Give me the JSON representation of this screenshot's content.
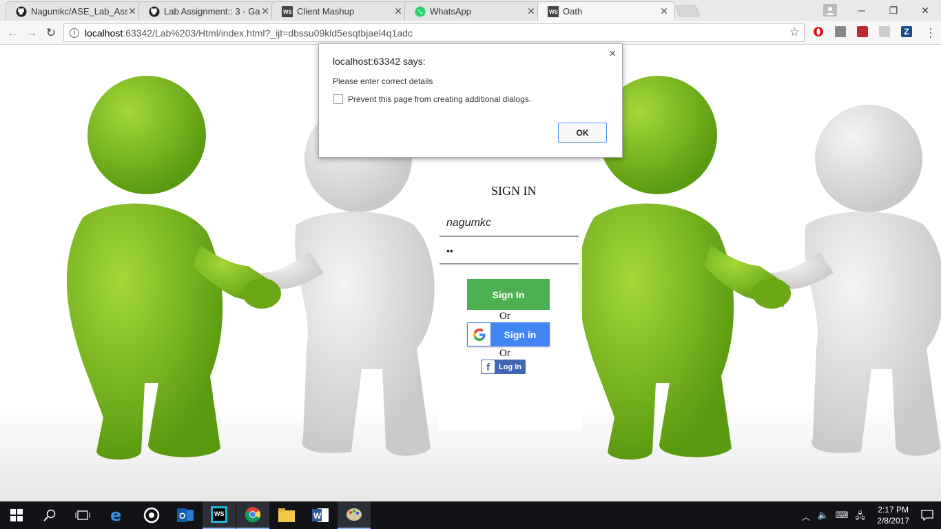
{
  "browser": {
    "tabs": [
      {
        "title": "Nagumkc/ASE_Lab_Assig",
        "icon": "github-icon"
      },
      {
        "title": "Lab Assignment:: 3 - Gay",
        "icon": "github-icon"
      },
      {
        "title": "Client Mashup",
        "icon": "webstorm-icon"
      },
      {
        "title": "WhatsApp",
        "icon": "whatsapp-icon"
      },
      {
        "title": "Oath",
        "icon": "webstorm-icon",
        "active": true
      }
    ],
    "url_host": "localhost",
    "url_rest": ":63342/Lab%203/Html/index.html?_ijt=dbssu09kld5esqtbjael4q1adc"
  },
  "dialog": {
    "title": "localhost:63342 says:",
    "message": "Please enter correct details",
    "checkbox_label": "Prevent this page from creating additional dialogs.",
    "ok_label": "OK",
    "close_glyph": "×"
  },
  "signin": {
    "heading": "SIGN IN",
    "username_value": "nagumkc",
    "password_value": "••",
    "signin_label": "Sign In",
    "or_label": "Or",
    "google_label": "Sign in",
    "facebook_label": "Log In"
  },
  "taskbar": {
    "time": "2:17 PM",
    "date": "2/8/2017"
  },
  "colors": {
    "signin_green": "#4caf50",
    "google_blue": "#4285f4",
    "facebook_blue": "#4267b2",
    "figure_green": "#7cb518"
  }
}
